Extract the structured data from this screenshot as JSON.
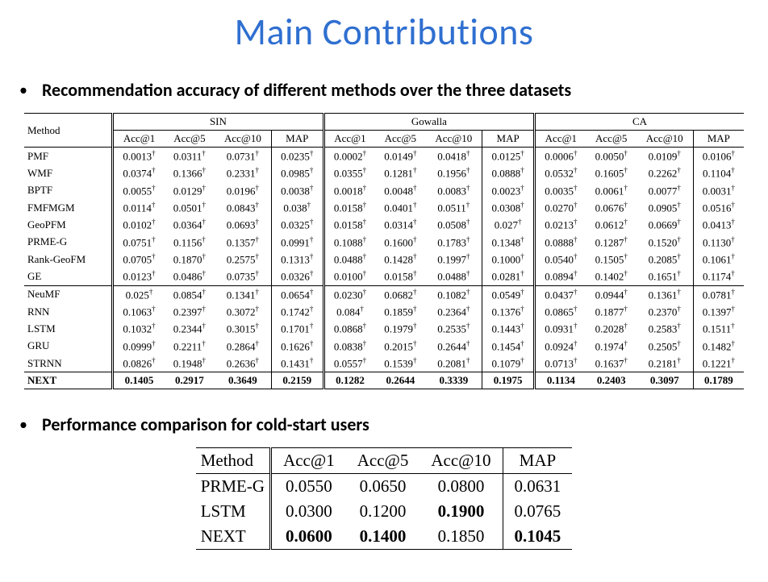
{
  "title": "Main Contributions",
  "bullet1": "Recommendation accuracy of different methods over the three datasets",
  "bullet2": "Performance comparison for cold-start users",
  "t1": {
    "method_header": "Method",
    "datasets": [
      "SIN",
      "Gowalla",
      "CA"
    ],
    "metrics": [
      "Acc@1",
      "Acc@5",
      "Acc@10",
      "MAP"
    ],
    "groups": [
      [
        {
          "name": "PMF",
          "v": [
            "0.0013†",
            "0.0311†",
            "0.0731†",
            "0.0235†",
            "0.0002†",
            "0.0149†",
            "0.0418†",
            "0.0125†",
            "0.0006†",
            "0.0050†",
            "0.0109†",
            "0.0106†"
          ]
        },
        {
          "name": "WMF",
          "v": [
            "0.0374†",
            "0.1366†",
            "0.2331†",
            "0.0985†",
            "0.0355†",
            "0.1281†",
            "0.1956†",
            "0.0888†",
            "0.0532†",
            "0.1605†",
            "0.2262†",
            "0.1104†"
          ]
        },
        {
          "name": "BPTF",
          "v": [
            "0.0055†",
            "0.0129†",
            "0.0196†",
            "0.0038†",
            "0.0018†",
            "0.0048†",
            "0.0083†",
            "0.0023†",
            "0.0035†",
            "0.0061†",
            "0.0077†",
            "0.0031†"
          ]
        },
        {
          "name": "FMFMGM",
          "v": [
            "0.0114†",
            "0.0501†",
            "0.0843†",
            "0.038†",
            "0.0158†",
            "0.0401†",
            "0.0511†",
            "0.0308†",
            "0.0270†",
            "0.0676†",
            "0.0905†",
            "0.0516†"
          ]
        },
        {
          "name": "GeoPFM",
          "v": [
            "0.0102†",
            "0.0364†",
            "0.0693†",
            "0.0325†",
            "0.0158†",
            "0.0314†",
            "0.0508†",
            "0.027†",
            "0.0213†",
            "0.0612†",
            "0.0669†",
            "0.0413†"
          ]
        },
        {
          "name": "PRME-G",
          "v": [
            "0.0751†",
            "0.1156†",
            "0.1357†",
            "0.0991†",
            "0.1088†",
            "0.1600†",
            "0.1783†",
            "0.1348†",
            "0.0888†",
            "0.1287†",
            "0.1520†",
            "0.1130†"
          ]
        },
        {
          "name": "Rank-GeoFM",
          "v": [
            "0.0705†",
            "0.1870†",
            "0.2575†",
            "0.1313†",
            "0.0488†",
            "0.1428†",
            "0.1997†",
            "0.1000†",
            "0.0540†",
            "0.1505†",
            "0.2085†",
            "0.1061†"
          ]
        },
        {
          "name": "GE",
          "v": [
            "0.0123†",
            "0.0486†",
            "0.0735†",
            "0.0326†",
            "0.0100†",
            "0.0158†",
            "0.0488†",
            "0.0281†",
            "0.0894†",
            "0.1402†",
            "0.1651†",
            "0.1174†"
          ]
        }
      ],
      [
        {
          "name": "NeuMF",
          "v": [
            "0.025†",
            "0.0854†",
            "0.1341†",
            "0.0654†",
            "0.0230†",
            "0.0682†",
            "0.1082†",
            "0.0549†",
            "0.0437†",
            "0.0944†",
            "0.1361†",
            "0.0781†"
          ]
        },
        {
          "name": "RNN",
          "v": [
            "0.1063†",
            "0.2397†",
            "0.3072†",
            "0.1742†",
            "0.084†",
            "0.1859†",
            "0.2364†",
            "0.1376†",
            "0.0865†",
            "0.1877†",
            "0.2370†",
            "0.1397†"
          ]
        },
        {
          "name": "LSTM",
          "v": [
            "0.1032†",
            "0.2344†",
            "0.3015†",
            "0.1701†",
            "0.0868†",
            "0.1979†",
            "0.2535†",
            "0.1443†",
            "0.0931†",
            "0.2028†",
            "0.2583†",
            "0.1511†"
          ]
        },
        {
          "name": "GRU",
          "v": [
            "0.0999†",
            "0.2211†",
            "0.2864†",
            "0.1626†",
            "0.0838†",
            "0.2015†",
            "0.2644†",
            "0.1454†",
            "0.0924†",
            "0.1974†",
            "0.2505†",
            "0.1482†"
          ]
        },
        {
          "name": "STRNN",
          "v": [
            "0.0826†",
            "0.1948†",
            "0.2636†",
            "0.1431†",
            "0.0557†",
            "0.1539†",
            "0.2081†",
            "0.1079†",
            "0.0713†",
            "0.1637†",
            "0.2181†",
            "0.1221†"
          ]
        }
      ],
      [
        {
          "name": "NEXT",
          "bold": true,
          "v": [
            "0.1405",
            "0.2917",
            "0.3649",
            "0.2159",
            "0.1282",
            "0.2644",
            "0.3339",
            "0.1975",
            "0.1134",
            "0.2403",
            "0.3097",
            "0.1789"
          ]
        }
      ]
    ]
  },
  "t2": {
    "headers": [
      "Method",
      "Acc@1",
      "Acc@5",
      "Acc@10",
      "MAP"
    ],
    "rows": [
      {
        "name": "PRME-G",
        "v": [
          "0.0550",
          "0.0650",
          "0.0800",
          "0.0631"
        ],
        "bold": [
          false,
          false,
          false,
          false
        ]
      },
      {
        "name": "LSTM",
        "v": [
          "0.0300",
          "0.1200",
          "0.1900",
          "0.0765"
        ],
        "bold": [
          false,
          false,
          true,
          false
        ]
      },
      {
        "name": "NEXT",
        "v": [
          "0.0600",
          "0.1400",
          "0.1850",
          "0.1045"
        ],
        "bold": [
          true,
          true,
          false,
          true
        ]
      }
    ]
  },
  "chart_data": [
    {
      "type": "table",
      "title": "Recommendation accuracy of different methods over the three datasets",
      "columns": [
        "Method",
        "SIN Acc@1",
        "SIN Acc@5",
        "SIN Acc@10",
        "SIN MAP",
        "Gowalla Acc@1",
        "Gowalla Acc@5",
        "Gowalla Acc@10",
        "Gowalla MAP",
        "CA Acc@1",
        "CA Acc@5",
        "CA Acc@10",
        "CA MAP"
      ],
      "rows": [
        [
          "PMF",
          0.0013,
          0.0311,
          0.0731,
          0.0235,
          0.0002,
          0.0149,
          0.0418,
          0.0125,
          0.0006,
          0.005,
          0.0109,
          0.0106
        ],
        [
          "WMF",
          0.0374,
          0.1366,
          0.2331,
          0.0985,
          0.0355,
          0.1281,
          0.1956,
          0.0888,
          0.0532,
          0.1605,
          0.2262,
          0.1104
        ],
        [
          "BPTF",
          0.0055,
          0.0129,
          0.0196,
          0.0038,
          0.0018,
          0.0048,
          0.0083,
          0.0023,
          0.0035,
          0.0061,
          0.0077,
          0.0031
        ],
        [
          "FMFMGM",
          0.0114,
          0.0501,
          0.0843,
          0.038,
          0.0158,
          0.0401,
          0.0511,
          0.0308,
          0.027,
          0.0676,
          0.0905,
          0.0516
        ],
        [
          "GeoPFM",
          0.0102,
          0.0364,
          0.0693,
          0.0325,
          0.0158,
          0.0314,
          0.0508,
          0.027,
          0.0213,
          0.0612,
          0.0669,
          0.0413
        ],
        [
          "PRME-G",
          0.0751,
          0.1156,
          0.1357,
          0.0991,
          0.1088,
          0.16,
          0.1783,
          0.1348,
          0.0888,
          0.1287,
          0.152,
          0.113
        ],
        [
          "Rank-GeoFM",
          0.0705,
          0.187,
          0.2575,
          0.1313,
          0.0488,
          0.1428,
          0.1997,
          0.1,
          0.054,
          0.1505,
          0.2085,
          0.1061
        ],
        [
          "GE",
          0.0123,
          0.0486,
          0.0735,
          0.0326,
          0.01,
          0.0158,
          0.0488,
          0.0281,
          0.0894,
          0.1402,
          0.1651,
          0.1174
        ],
        [
          "NeuMF",
          0.025,
          0.0854,
          0.1341,
          0.0654,
          0.023,
          0.0682,
          0.1082,
          0.0549,
          0.0437,
          0.0944,
          0.1361,
          0.0781
        ],
        [
          "RNN",
          0.1063,
          0.2397,
          0.3072,
          0.1742,
          0.084,
          0.1859,
          0.2364,
          0.1376,
          0.0865,
          0.1877,
          0.237,
          0.1397
        ],
        [
          "LSTM",
          0.1032,
          0.2344,
          0.3015,
          0.1701,
          0.0868,
          0.1979,
          0.2535,
          0.1443,
          0.0931,
          0.2028,
          0.2583,
          0.1511
        ],
        [
          "GRU",
          0.0999,
          0.2211,
          0.2864,
          0.1626,
          0.0838,
          0.2015,
          0.2644,
          0.1454,
          0.0924,
          0.1974,
          0.2505,
          0.1482
        ],
        [
          "STRNN",
          0.0826,
          0.1948,
          0.2636,
          0.1431,
          0.0557,
          0.1539,
          0.2081,
          0.1079,
          0.0713,
          0.1637,
          0.2181,
          0.1221
        ],
        [
          "NEXT",
          0.1405,
          0.2917,
          0.3649,
          0.2159,
          0.1282,
          0.2644,
          0.3339,
          0.1975,
          0.1134,
          0.2403,
          0.3097,
          0.1789
        ]
      ]
    },
    {
      "type": "table",
      "title": "Performance comparison for cold-start users",
      "columns": [
        "Method",
        "Acc@1",
        "Acc@5",
        "Acc@10",
        "MAP"
      ],
      "rows": [
        [
          "PRME-G",
          0.055,
          0.065,
          0.08,
          0.0631
        ],
        [
          "LSTM",
          0.03,
          0.12,
          0.19,
          0.0765
        ],
        [
          "NEXT",
          0.06,
          0.14,
          0.185,
          0.1045
        ]
      ]
    }
  ]
}
